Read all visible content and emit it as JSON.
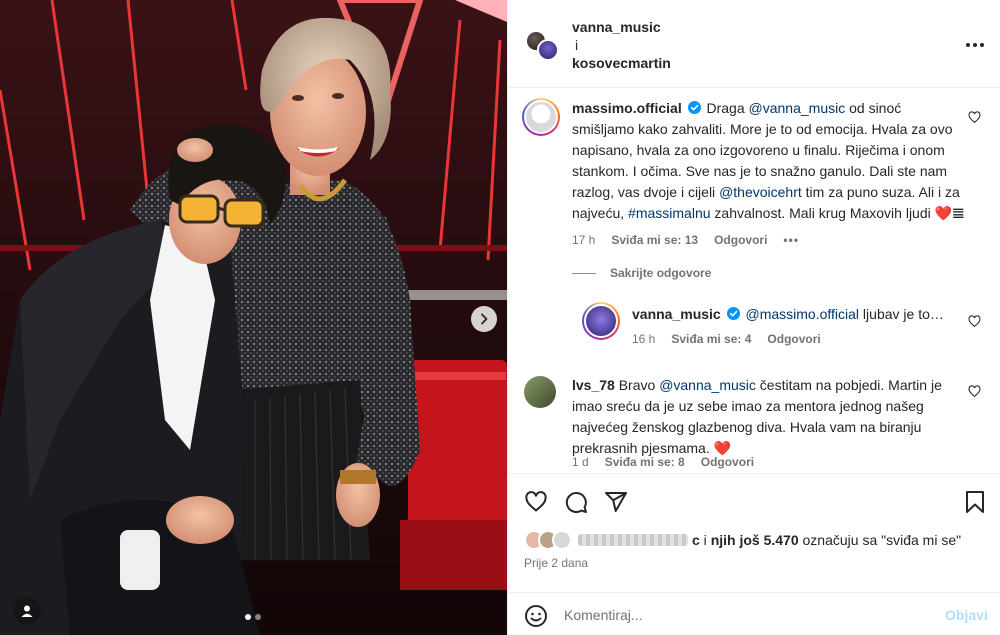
{
  "post_header": {
    "user1": "vanna_music",
    "conjunction": "i",
    "user2": "kosovecmartin",
    "more_icon": "more-horizontal-icon"
  },
  "comments": [
    {
      "username": "massimo.official",
      "verified": true,
      "text_segments": [
        {
          "t": "Draga ",
          "mention": false
        },
        {
          "t": "@vanna_music",
          "mention": true
        },
        {
          "t": " od sinoć smišljamo kako zahvaliti. More je to od emocija. Hvala za ovo napisano, hvala za ono izgovoreno u finalu. Riječima i onom stankom. I očima. Sve nas je to snažno ganulo. Dali ste nam razlog, vas dvoje i cijeli ",
          "mention": false
        },
        {
          "t": "@thevoicehrt",
          "mention": true
        },
        {
          "t": " tim za puno suza. Ali i za najveću, ",
          "mention": false
        },
        {
          "t": "#massimalnu",
          "mention": true
        },
        {
          "t": " zahvalnost. Mali krug Maxovih ljudi ❤️𝌆",
          "mention": false
        }
      ],
      "time": "17 h",
      "likes": "Sviđa mi se: 13",
      "reply_label": "Odgovori",
      "options_label": "•••"
    },
    {
      "hide_replies_label": "Sakrijte odgovore"
    },
    {
      "username": "vanna_music",
      "verified": true,
      "text_segments": [
        {
          "t": "@massimo.official",
          "mention": true
        },
        {
          "t": " ljubav je to…",
          "mention": false
        }
      ],
      "time": "16 h",
      "likes": "Sviđa mi se: 4",
      "reply_label": "Odgovori"
    },
    {
      "username": "lvs_78",
      "verified": false,
      "text_segments": [
        {
          "t": " Bravo ",
          "mention": false
        },
        {
          "t": "@vanna_music",
          "mention": true
        },
        {
          "t": " čestitam na pobjedi. Martin je imao sreću da je uz sebe imao za mentora jednog našeg najvećeg ženskog glazbenog diva. Hvala vam na biranju prekrasnih pjesmama. ❤️",
          "mention": false
        }
      ],
      "time": "1 d",
      "likes": "Sviđa mi se: 8",
      "reply_label": "Odgovori"
    }
  ],
  "actions": {
    "like_icon": "heart-icon",
    "comment_icon": "comment-icon",
    "share_icon": "send-icon",
    "save_icon": "bookmark-icon"
  },
  "likes_summary": {
    "blurred_name_tail": "c",
    "connector": " i ",
    "bold_part": "njih još 5.470",
    "rest": " označuju sa \"sviđa mi se\""
  },
  "posted_ago": "Prije 2 dana",
  "comment_box": {
    "placeholder": "Komentiraj...",
    "post_label": "Objavi",
    "emoji_icon": "emoji-icon"
  },
  "photo": {
    "carousel_total": 2,
    "carousel_active": 1,
    "next_icon": "chevron-right-icon",
    "tag_icon": "user-tag-icon"
  },
  "colors": {
    "mention": "#00376b",
    "secondary_text": "#737373",
    "post_disabled": "#b3dbff",
    "verified": "#0095f6",
    "heart_red": "#ed4956"
  }
}
